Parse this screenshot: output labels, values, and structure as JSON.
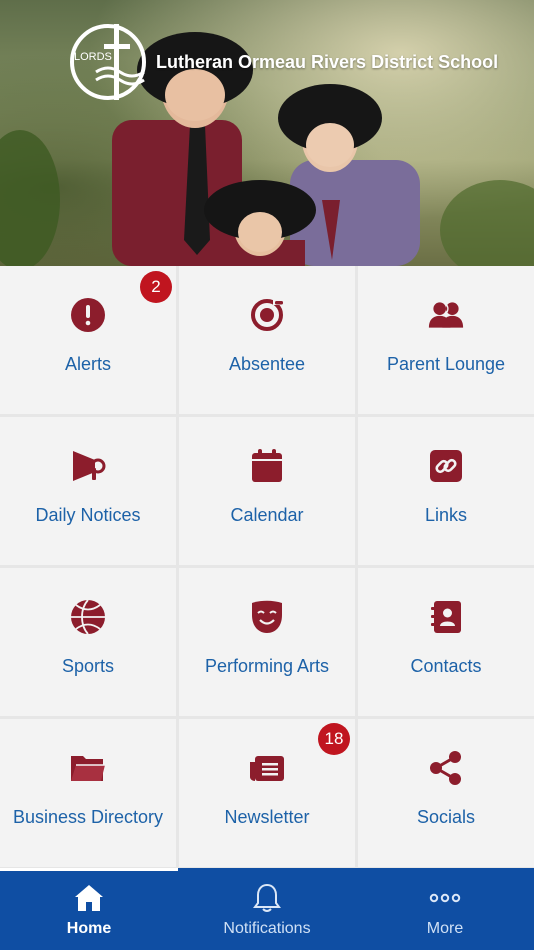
{
  "header": {
    "school_name": "Lutheran Ormeau Rivers District School",
    "logo_text": "LORDS"
  },
  "tiles": [
    {
      "label": "Alerts",
      "icon": "alert-icon",
      "badge": "2"
    },
    {
      "label": "Absentee",
      "icon": "absentee-icon"
    },
    {
      "label": "Parent Lounge",
      "icon": "parent-lounge-icon"
    },
    {
      "label": "Daily Notices",
      "icon": "megaphone-icon"
    },
    {
      "label": "Calendar",
      "icon": "calendar-icon"
    },
    {
      "label": "Links",
      "icon": "link-icon"
    },
    {
      "label": "Sports",
      "icon": "basketball-icon"
    },
    {
      "label": "Performing Arts",
      "icon": "theatre-mask-icon"
    },
    {
      "label": "Contacts",
      "icon": "address-book-icon"
    },
    {
      "label": "Business Directory",
      "icon": "folder-icon"
    },
    {
      "label": "Newsletter",
      "icon": "newsletter-icon",
      "badge": "18"
    },
    {
      "label": "Socials",
      "icon": "share-icon"
    }
  ],
  "tabbar": {
    "home": "Home",
    "notifications": "Notifications",
    "more": "More",
    "active": "home"
  },
  "colors": {
    "icon": "#8c1d2c",
    "label": "#1d62a8",
    "badge": "#c0151f",
    "tabbar": "#0f4ea3"
  }
}
